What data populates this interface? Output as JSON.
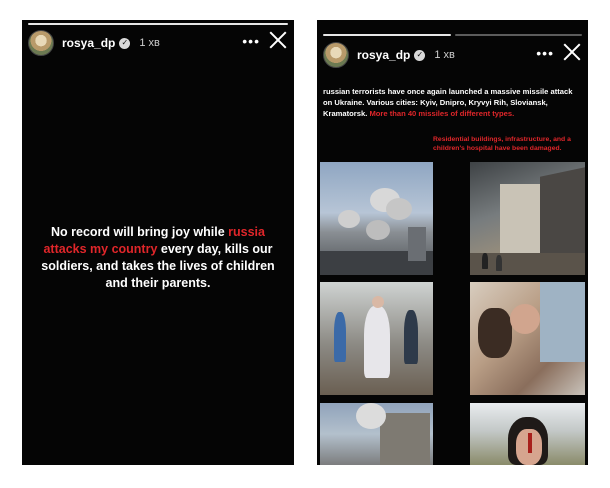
{
  "left_story": {
    "username": "rosya_dp",
    "verified_icon": "verified-badge-icon",
    "timestamp": "1 хв",
    "more_icon": "more-dots-icon",
    "close_icon": "close-icon",
    "message": {
      "part1": "No record will bring joy while ",
      "highlight": "russia attacks my country",
      "part2": " every day, kills our soldiers, and takes the lives of children and their parents."
    },
    "highlight_color": "#e0262a"
  },
  "right_story": {
    "username": "rosya_dp",
    "verified_icon": "verified-badge-icon",
    "timestamp": "1 хв",
    "more_icon": "more-dots-icon",
    "close_icon": "close-icon",
    "caption": {
      "part1": "russian terrorists have once again launched a massive missile attack on Ukraine. Various cities: Kyiv, Dnipro, Kryvyi Rih, Sloviansk, Kramatorsk. ",
      "highlight": "More than 40 missiles of different types."
    },
    "caption2": "Residential buildings, infrastructure, and a children's hospital have been damaged.",
    "photos": [
      "explosion-smoke-photo",
      "destroyed-building-photo",
      "injured-woman-photo",
      "hospital-rescue-photo",
      "damaged-street-photo",
      "injured-girl-photo"
    ]
  }
}
